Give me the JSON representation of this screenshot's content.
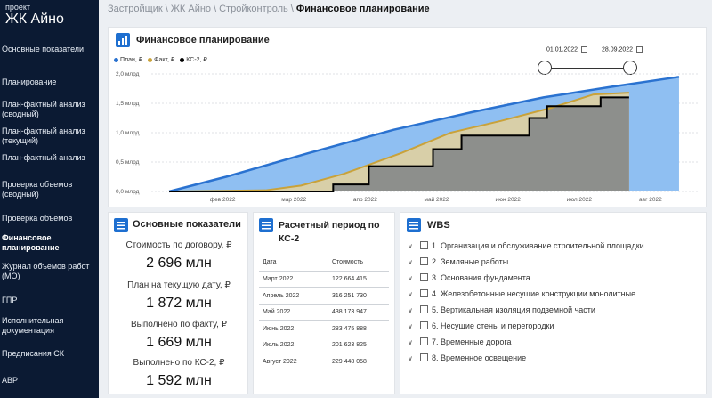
{
  "sidebar": {
    "project_label": "проект",
    "project_name": "ЖК Айно",
    "items": [
      {
        "label": "Основные показатели",
        "active": false
      },
      {
        "label": "Планирование",
        "active": false
      },
      {
        "label": "План-фактный анализ (сводный)",
        "active": false
      },
      {
        "label": "План-фактный анализ (текущий)",
        "active": false
      },
      {
        "label": "План-фактный анализ",
        "active": false
      },
      {
        "label": "Проверка объемов (сводный)",
        "active": false
      },
      {
        "label": "Проверка объемов",
        "active": false
      },
      {
        "label": "Финансовое планирование",
        "active": true
      },
      {
        "label": "Журнал объемов работ (МО)",
        "active": false
      },
      {
        "label": "ГПР",
        "active": false
      },
      {
        "label": "Исполнительная документация",
        "active": false
      },
      {
        "label": "Предписания СК",
        "active": false
      },
      {
        "label": "АВР",
        "active": false
      }
    ]
  },
  "breadcrumb": {
    "items": [
      "Застройщик",
      "ЖК  Айно",
      "Стройконтроль"
    ],
    "current": "Финансовое планирование"
  },
  "chart_card": {
    "title": "Финансовое планирование",
    "date_from": "01.01.2022",
    "date_to": "28.09.2022",
    "slider_range": [
      0.0,
      1.0
    ]
  },
  "chart_data": {
    "type": "area",
    "colors": {
      "plan": "#2a72d0",
      "plan_fill": "#8fbff2",
      "fact": "#c9a23a",
      "fact_fill": "#d8cfa8",
      "ks2": "#000000",
      "ks2_fill": "#8d8f8c"
    },
    "series": [
      {
        "name": "План, ₽",
        "unit": "млрд",
        "points": [
          [
            0.25,
            0.0
          ],
          [
            1.05,
            0.25
          ],
          [
            2.2,
            0.65
          ],
          [
            3.4,
            1.05
          ],
          [
            4.5,
            1.35
          ],
          [
            5.5,
            1.6
          ],
          [
            6.45,
            1.78
          ],
          [
            7.4,
            1.95
          ]
        ]
      },
      {
        "name": "Факт, ₽",
        "unit": "млрд",
        "points": [
          [
            0.25,
            0.0
          ],
          [
            1.6,
            0.02
          ],
          [
            2.1,
            0.1
          ],
          [
            2.7,
            0.3
          ],
          [
            3.5,
            0.65
          ],
          [
            4.2,
            1.0
          ],
          [
            4.9,
            1.2
          ],
          [
            5.6,
            1.42
          ],
          [
            6.2,
            1.65
          ],
          [
            6.7,
            1.68
          ]
        ]
      },
      {
        "name": "КС-2, ₽",
        "unit": "млрд",
        "steps": [
          [
            0.25,
            0.0
          ],
          [
            2.55,
            0.12
          ],
          [
            3.05,
            0.43
          ],
          [
            3.95,
            0.72
          ],
          [
            4.35,
            0.95
          ],
          [
            5.3,
            1.25
          ],
          [
            5.55,
            1.45
          ],
          [
            6.3,
            1.6
          ],
          [
            6.7,
            1.6
          ]
        ]
      }
    ],
    "x_ticks": [
      "фев 2022",
      "мар 2022",
      "апр 2022",
      "май 2022",
      "июн 2022",
      "июл 2022",
      "авг 2022",
      "сен 2022"
    ],
    "y_ticks": [
      "0,0 млрд",
      "0,5 млрд",
      "1,0 млрд",
      "1,5 млрд",
      "2,0 млрд"
    ],
    "y_values": [
      0,
      0.5,
      1.0,
      1.5,
      2.0
    ],
    "ylim": [
      0,
      2.0
    ],
    "xlim": [
      0,
      7.7
    ],
    "grid": true,
    "legend_position": "top-left"
  },
  "kpi_card": {
    "title": "Основные показатели",
    "items": [
      {
        "label": "Стоимость по договору, ₽",
        "value": "2 696 млн"
      },
      {
        "label": "План на текущую дату, ₽",
        "value": "1 872 млн"
      },
      {
        "label": "Выполнено по факту, ₽",
        "value": "1 669 млн"
      },
      {
        "label": "Выполнено по КС-2, ₽",
        "value": "1 592 млн"
      }
    ]
  },
  "period_card": {
    "title": "Расчетный период по КС-2",
    "col_date": "Дата",
    "col_cost": "Стоимость",
    "rows": [
      {
        "date": "Март 2022",
        "cost": "122 664 415"
      },
      {
        "date": "Апрель 2022",
        "cost": "316 251 730"
      },
      {
        "date": "Май 2022",
        "cost": "438 173 947"
      },
      {
        "date": "Июнь 2022",
        "cost": "283 475 888"
      },
      {
        "date": "Июль 2022",
        "cost": "201 623 825"
      },
      {
        "date": "Август 2022",
        "cost": "229 448 058"
      }
    ]
  },
  "wbs_card": {
    "title": "WBS",
    "items": [
      "1. Организация и обслуживание строительной площадки",
      "2. Земляные работы",
      "3. Основания фундамента",
      "4. Железобетонные несущие конструкции монолитные",
      "5. Вертикальная изоляция подземной части",
      "6. Несущие стены и перегородки",
      "7. Временные дорога",
      "8. Временное освещение"
    ]
  }
}
